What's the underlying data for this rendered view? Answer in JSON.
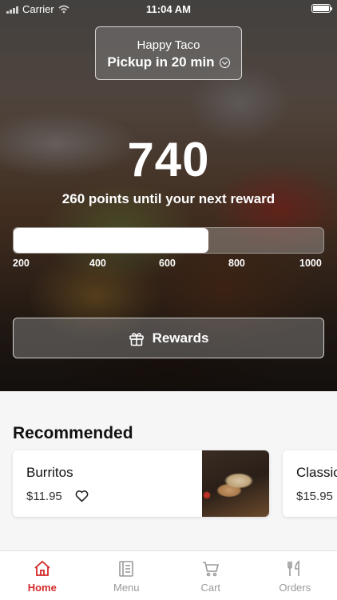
{
  "status_bar": {
    "carrier": "Carrier",
    "time": "11:04 AM"
  },
  "store": {
    "name": "Happy Taco",
    "pickup": "Pickup in 20 min"
  },
  "rewards": {
    "points": "740",
    "message": "260 points until your next reward",
    "progress_fraction": 0.63,
    "ticks": [
      "200",
      "400",
      "600",
      "800",
      "1000"
    ],
    "button_label": "Rewards"
  },
  "recommended": {
    "title": "Recommended",
    "items": [
      {
        "name": "Burritos",
        "price": "$11.95",
        "icon": "heart-icon"
      },
      {
        "name": "Classic",
        "price": "$15.95"
      }
    ]
  },
  "tabs": [
    {
      "label": "Home",
      "icon": "home-icon",
      "active": true
    },
    {
      "label": "Menu",
      "icon": "menu-icon",
      "active": false
    },
    {
      "label": "Cart",
      "icon": "cart-icon",
      "active": false
    },
    {
      "label": "Orders",
      "icon": "cutlery-icon",
      "active": false
    }
  ],
  "colors": {
    "accent": "#d42a2a",
    "inactive": "#9a9a9a"
  }
}
